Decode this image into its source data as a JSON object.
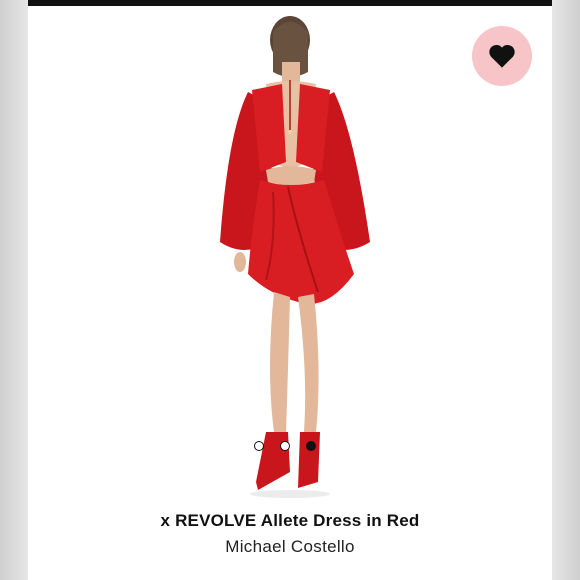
{
  "product": {
    "title": "x REVOLVE Allete Dress in Red",
    "brand": "Michael Costello"
  },
  "gallery": {
    "slides": 3,
    "active_index": 2
  },
  "favorite": {
    "icon": "heart-icon",
    "background": "#f7c5c8"
  },
  "colors": {
    "dress": "#d81e22",
    "accent": "#111111"
  }
}
